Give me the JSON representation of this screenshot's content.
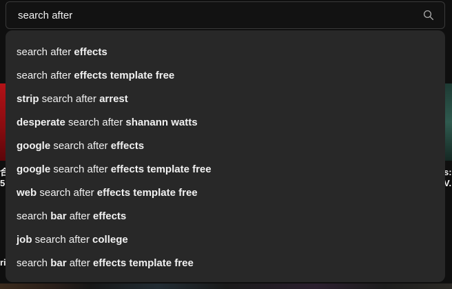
{
  "search": {
    "query": "search after",
    "icon": "search-icon"
  },
  "suggestions": [
    [
      {
        "t": "search after ",
        "b": false
      },
      {
        "t": "effects",
        "b": true
      }
    ],
    [
      {
        "t": "search after ",
        "b": false
      },
      {
        "t": "effects template free",
        "b": true
      }
    ],
    [
      {
        "t": "strip",
        "b": true
      },
      {
        "t": " search after ",
        "b": false
      },
      {
        "t": "arrest",
        "b": true
      }
    ],
    [
      {
        "t": "desperate",
        "b": true
      },
      {
        "t": " search after ",
        "b": false
      },
      {
        "t": "shanann watts",
        "b": true
      }
    ],
    [
      {
        "t": "google",
        "b": true
      },
      {
        "t": " search after ",
        "b": false
      },
      {
        "t": "effects",
        "b": true
      }
    ],
    [
      {
        "t": "google",
        "b": true
      },
      {
        "t": " search after ",
        "b": false
      },
      {
        "t": "effects template free",
        "b": true
      }
    ],
    [
      {
        "t": "web",
        "b": true
      },
      {
        "t": " search after ",
        "b": false
      },
      {
        "t": "effects template free",
        "b": true
      }
    ],
    [
      {
        "t": "search ",
        "b": false
      },
      {
        "t": "bar",
        "b": true
      },
      {
        "t": " after ",
        "b": false
      },
      {
        "t": "effects",
        "b": true
      }
    ],
    [
      {
        "t": "job",
        "b": true
      },
      {
        "t": " search after ",
        "b": false
      },
      {
        "t": "college",
        "b": true
      }
    ],
    [
      {
        "t": "search ",
        "b": false
      },
      {
        "t": "bar",
        "b": true
      },
      {
        "t": " after ",
        "b": false
      },
      {
        "t": "effects template free",
        "b": true
      }
    ]
  ],
  "background_fragments": {
    "left_1": "合",
    "left_2": "5.",
    "left_3": "ri",
    "right_1": "s:",
    "right_2": "V..."
  },
  "colors": {
    "page_bg": "#0f0f0f",
    "search_bg": "#121212",
    "dropdown_bg": "#282828",
    "text": "#f1f1f1",
    "icon": "#aaaaaa"
  }
}
